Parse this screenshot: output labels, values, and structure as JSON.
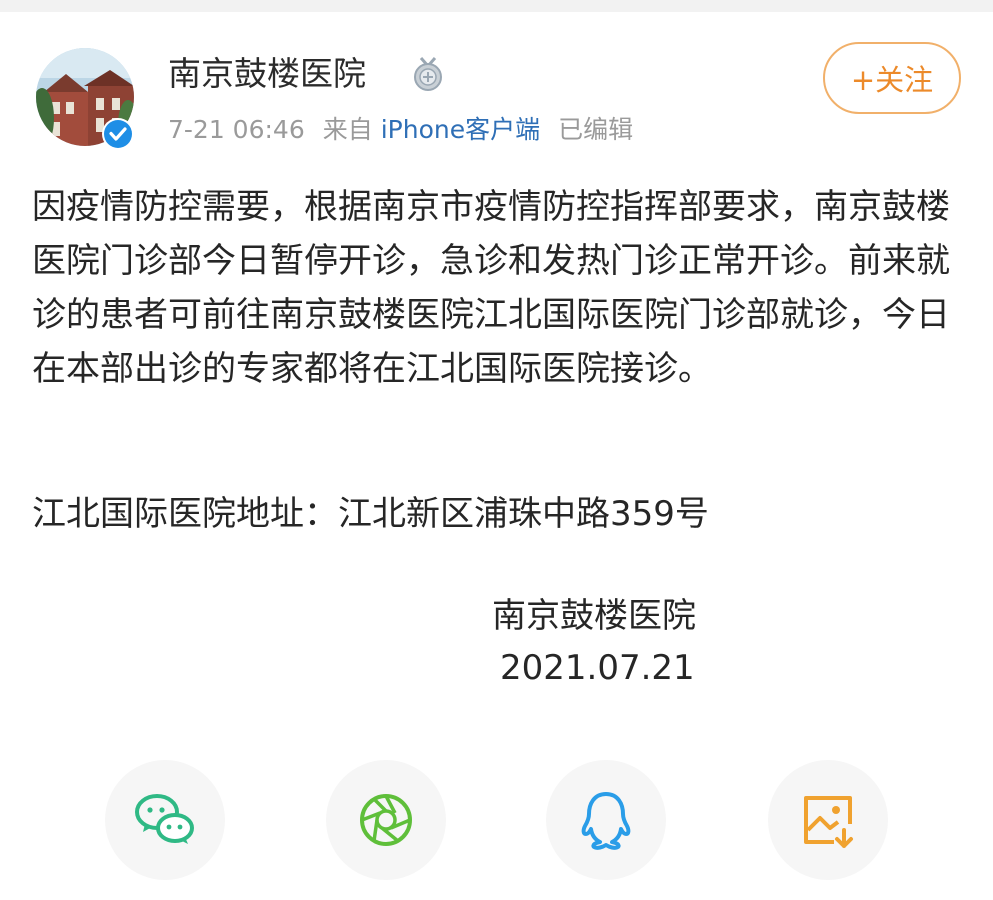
{
  "post": {
    "author": "南京鼓楼医院",
    "time": "7-21 06:46",
    "source_prefix": "来自",
    "source": "iPhone客户端",
    "edited": "已编辑",
    "follow_label": "+关注",
    "paragraphs": [
      "因疫情防控需要，根据南京市疫情防控指挥部要求，南京鼓楼医院门诊部今日暂停开诊，急诊和发热门诊正常开诊。前来就诊的患者可前往南京鼓楼医院江北国际医院门诊部就诊，今日在本部出诊的专家都将在江北国际医院接诊。"
    ],
    "address": "江北国际医院地址：江北新区浦珠中路359号",
    "signature_name": "南京鼓楼医院",
    "signature_date": "2021.07.21"
  },
  "share_icons": [
    {
      "icon": "wechat-icon",
      "color": "#2fb985"
    },
    {
      "icon": "moments-icon",
      "color": "#5fbf3a"
    },
    {
      "icon": "qq-icon",
      "color": "#2a9de8"
    },
    {
      "icon": "save-image-icon",
      "color": "#f0a22f"
    }
  ],
  "colors": {
    "accent_orange": "#ec8a2a",
    "link_blue": "#2f6fb6",
    "verified_blue": "#1e8ee6"
  }
}
